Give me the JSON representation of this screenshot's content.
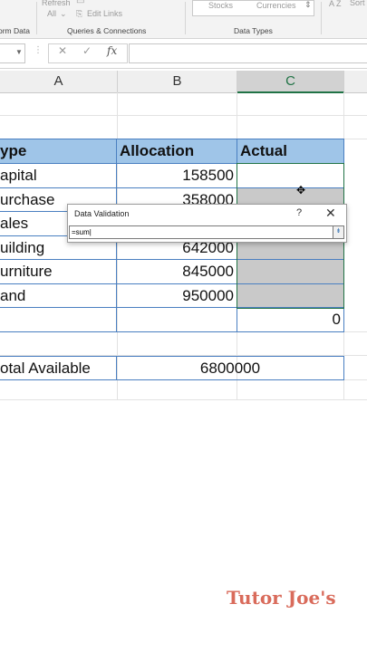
{
  "ribbon": {
    "refresh_all": "Refresh",
    "all_label": "All",
    "edit_links": "Edit Links",
    "stocks": "Stocks",
    "currencies": "Currencies",
    "sort_az": "A Z",
    "sort": "Sort",
    "group_from_data": "orm Data",
    "group_queries": "Queries & Connections",
    "group_data_types": "Data Types"
  },
  "formula_bar": {
    "cancel_symbol": "✕",
    "enter_symbol": "✓",
    "fx": "fx",
    "value": ""
  },
  "columns": [
    "A",
    "B",
    "C"
  ],
  "table": {
    "headers": [
      "ype",
      "Allocation",
      "Actual"
    ],
    "rows": [
      {
        "type": "apital",
        "allocation": "158500",
        "actual": ""
      },
      {
        "type": "urchase",
        "allocation": "358000",
        "actual": ""
      },
      {
        "type": "ales",
        "allocation": "",
        "actual": ""
      },
      {
        "type": "uilding",
        "allocation": "642000",
        "actual": ""
      },
      {
        "type": "urniture",
        "allocation": "845000",
        "actual": ""
      },
      {
        "type": "and",
        "allocation": "950000",
        "actual": ""
      }
    ],
    "total_actual": "0"
  },
  "summary": {
    "label": "otal Available",
    "value": "6800000"
  },
  "dialog": {
    "title": "Data Validation",
    "help": "?",
    "close": "✕",
    "input_value": "=sum|",
    "collapse_icon": "⇟"
  },
  "watermark": "Tutor Joe's",
  "colors": {
    "header_fill": "#9fc5e8",
    "table_border": "#4a7fc1",
    "selection_gray": "#c9c9c9",
    "excel_green": "#217346"
  }
}
